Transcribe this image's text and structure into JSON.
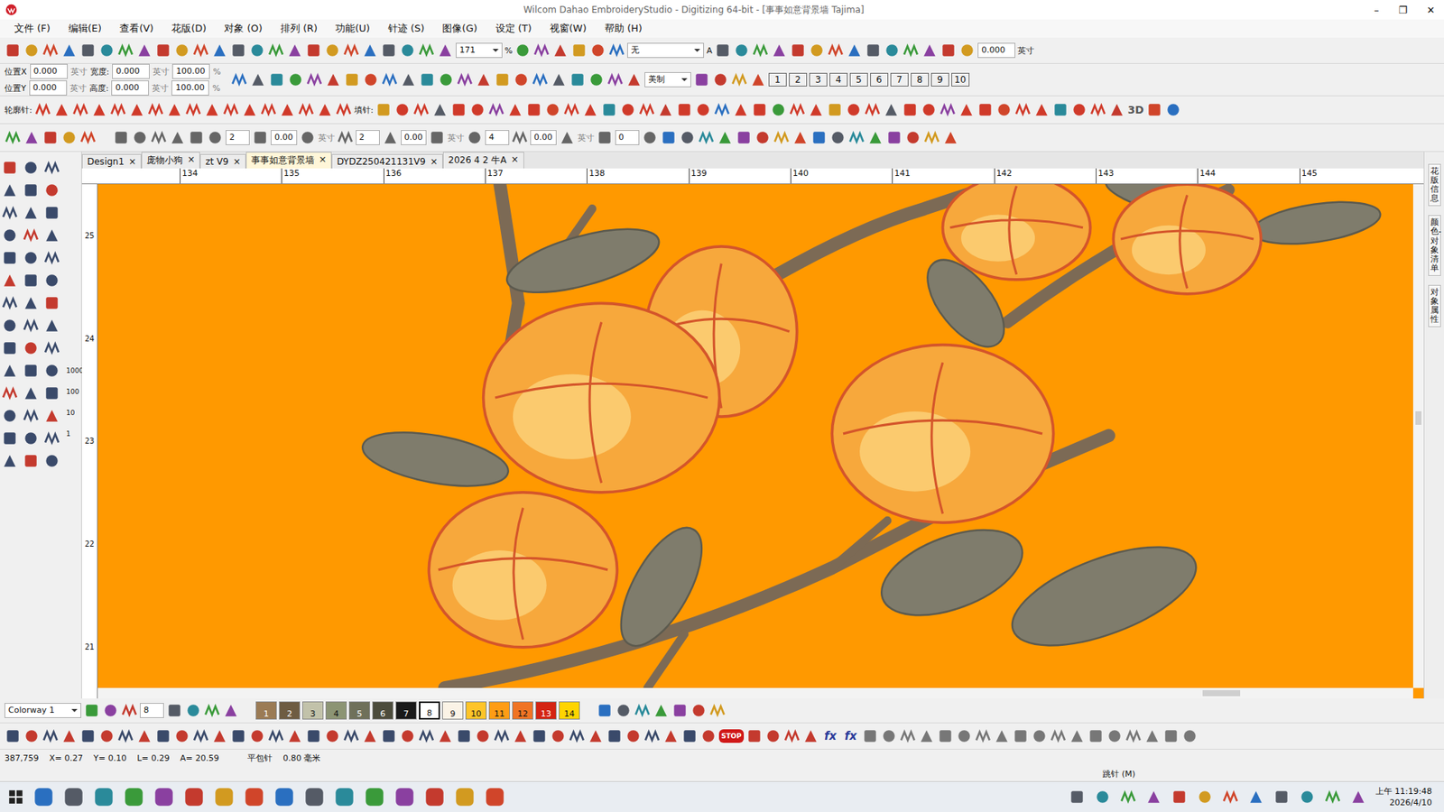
{
  "window": {
    "title": "Wilcom Dahao EmbroideryStudio - Digitizing 64-bit - [事事如意背景墙      Tajima]",
    "controls": [
      "–",
      "❐",
      "✕"
    ]
  },
  "menu": [
    "文件 (F)",
    "编辑(E)",
    "查看(V)",
    "花版(D)",
    "对象 (O)",
    "排列 (R)",
    "功能(U)",
    "针迹 (S)",
    "图像(G)",
    "设定 (T)",
    "视窗(W)",
    "帮助 (H)"
  ],
  "toolbar1": {
    "zoom": "171",
    "zoom_unit": "%",
    "color_select": "无",
    "a_label": "A",
    "value": "0.000",
    "unit": "英寸"
  },
  "toolbar2": {
    "rows": [
      {
        "pos_label": "位置X",
        "pos": "0.000",
        "unit": "英寸",
        "size_label": "宽度:",
        "size": "0.000",
        "size_unit": "英寸",
        "scale": "100.00",
        "pct": "%"
      },
      {
        "pos_label": "位置Y",
        "pos": "0.000",
        "unit": "英寸",
        "size_label": "高度:",
        "size": "0.000",
        "size_unit": "英寸",
        "scale": "100.00",
        "pct": "%"
      }
    ],
    "standard": "美制",
    "numbers": [
      "1",
      "2",
      "3",
      "4",
      "5",
      "6",
      "7",
      "8",
      "9",
      "10"
    ]
  },
  "toolbar3": {
    "outline_label": "轮廓针:",
    "fill_label": "填针:",
    "three_d": "3D"
  },
  "toolbar4": {
    "fields": [
      "2",
      "0.00",
      "英寸",
      "2",
      "0.00",
      "英寸",
      "4",
      "0.00",
      "英寸",
      "0"
    ]
  },
  "toolbox": {
    "labels": [
      "1000",
      "100",
      "10",
      "1"
    ]
  },
  "doc_tabs": {
    "close": "×",
    "items": [
      {
        "label": "Design1",
        "selected": false
      },
      {
        "label": "庞物小狗",
        "selected": false
      },
      {
        "label": "zt V9",
        "selected": false
      },
      {
        "label": "事事如意背景墙",
        "selected": true
      },
      {
        "label": "DYDZ250421131V9",
        "selected": false
      },
      {
        "label": "2026 4 2 牛A",
        "selected": false
      }
    ]
  },
  "ruler": {
    "top": [
      "134",
      "135",
      "136",
      "137",
      "138",
      "139",
      "140",
      "141",
      "142",
      "143",
      "144",
      "145"
    ],
    "left": [
      "25",
      "24",
      "23",
      "22",
      "21"
    ]
  },
  "side_tabs": [
    "花版信息",
    "颜色-对象清单",
    "对象属性"
  ],
  "colorway": {
    "name": "Colorway 1",
    "count": "8",
    "colors": [
      {
        "label": "1",
        "color": "#9b7b55",
        "selected": false
      },
      {
        "label": "2",
        "color": "#6e5c42",
        "selected": false
      },
      {
        "label": "3",
        "color": "#c2c2aa",
        "selected": false
      },
      {
        "label": "4",
        "color": "#8c9474",
        "selected": false
      },
      {
        "label": "5",
        "color": "#6f705a",
        "selected": false
      },
      {
        "label": "6",
        "color": "#4c4c3c",
        "selected": false
      },
      {
        "label": "7",
        "color": "#1a1a1a",
        "selected": false
      },
      {
        "label": "8",
        "color": "#ffffff",
        "selected": true
      },
      {
        "label": "9",
        "color": "#fbf3e6",
        "selected": false
      },
      {
        "label": "10",
        "color": "#ffc428",
        "selected": false
      },
      {
        "label": "11",
        "color": "#ff9c14",
        "selected": false
      },
      {
        "label": "12",
        "color": "#f07424",
        "selected": false
      },
      {
        "label": "13",
        "color": "#d42412",
        "selected": false
      },
      {
        "label": "14",
        "color": "#ffd400",
        "selected": false
      }
    ]
  },
  "bottom_toolbar": {
    "stop": "STOP",
    "fx": [
      "fx",
      "fx"
    ]
  },
  "status": {
    "coords": "387,759",
    "x": "X= 0.27",
    "y": "Y= 0.10",
    "l": "L= 0.29",
    "a": "A= 20.59",
    "stitch": "平包针",
    "length": "0.80 毫米",
    "mode": "跳针 (M)"
  },
  "taskbar": {
    "time": "上午 11:19:48",
    "date": "2026/4/10"
  }
}
